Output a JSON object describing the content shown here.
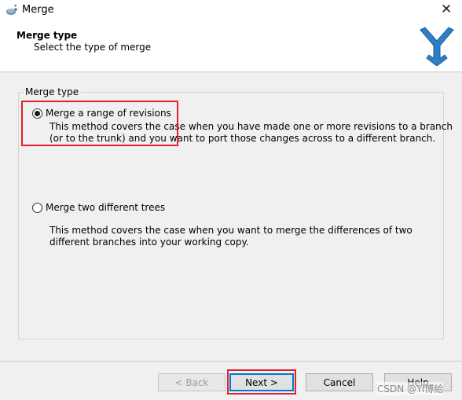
{
  "window": {
    "title": "Merge",
    "close_icon": "close-icon"
  },
  "header": {
    "title": "Merge type",
    "subtitle": "Select the type of merge",
    "logo": "merge-arrows-icon"
  },
  "group": {
    "label": "Merge type",
    "options": [
      {
        "label": "Merge a range of revisions",
        "checked": true,
        "description_line1": "This method covers the case when you have made one or more revisions to a branch",
        "description_line2": "(or to the trunk) and you want to port those changes across to a different branch."
      },
      {
        "label": "Merge two different trees",
        "checked": false,
        "description_line1": "This method covers the case when you want to merge the differences of two",
        "description_line2": "different branches into your working copy."
      }
    ]
  },
  "buttons": {
    "back": "< Back",
    "next": "Next >",
    "cancel": "Cancel",
    "help": "Help"
  },
  "watermark": "CSDN @Yi博給",
  "colors": {
    "highlight": "#e0202a",
    "logo_blue": "#2f7ec4",
    "focus": "#0078d7"
  }
}
